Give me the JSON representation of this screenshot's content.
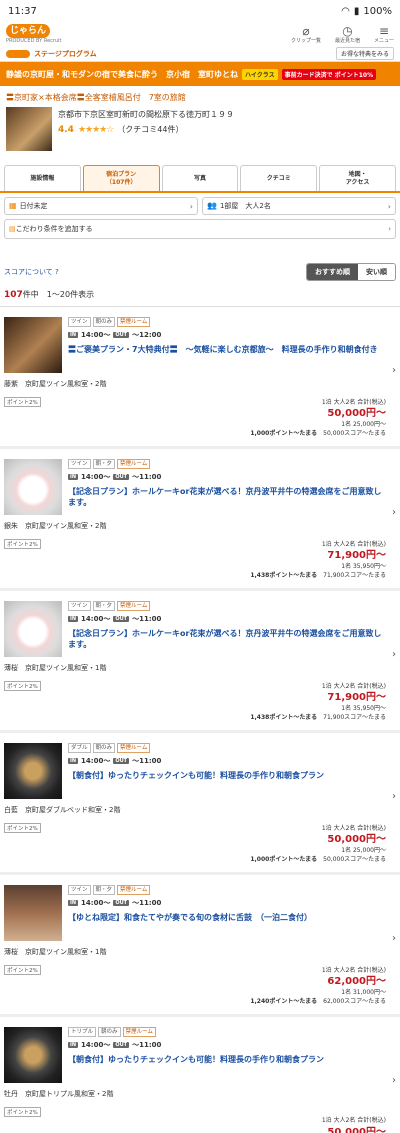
{
  "status_bar": {
    "time": "11:37",
    "battery": "100%"
  },
  "header": {
    "logo": "じゃらん",
    "logo_sub": "PRODUCED BY Recruit",
    "icons": [
      {
        "label": "クリップ一覧",
        "icon": "clip-icon"
      },
      {
        "label": "最近見た宿",
        "icon": "history-icon"
      },
      {
        "label": "メニュー",
        "icon": "menu-icon"
      }
    ]
  },
  "stage": {
    "label": "ステージプログラム",
    "link": "お得な特典をみる"
  },
  "banner": {
    "title": "静謐の京町屋・和モダンの宿で美食に酔う　京小宿　室町ゆとね",
    "badge1": "ハイクラス",
    "badge2": "事前カード決済で ポイント10%"
  },
  "catch": "〓京町家×本格会席〓全客室檜風呂付　7室の旅館",
  "hotel": {
    "address": "京都市下京区室町新町の間松原下る徳万町１９９",
    "score": "4.4",
    "stars": "★★★★☆",
    "reviews": "（クチコミ44件）"
  },
  "tabs": [
    {
      "label": "施設情報",
      "active": false
    },
    {
      "label": "宿泊プラン\n（107件）",
      "active": true
    },
    {
      "label": "写真",
      "active": false
    },
    {
      "label": "クチコミ",
      "active": false
    },
    {
      "label": "地図・\nアクセス",
      "active": false
    }
  ],
  "filters": {
    "date": "日付未定",
    "rooms": "1部屋　大人2名",
    "conditions": "こだわり条件を追加する"
  },
  "sort": {
    "about": "スコアについて",
    "recommended": "おすすめ順",
    "cheap": "安い順"
  },
  "count": {
    "total": "107",
    "unit": "件中",
    "range": "1〜20件表示"
  },
  "plans": [
    {
      "tags": [
        "ツイン",
        "朝のみ",
        "禁煙ルーム"
      ],
      "in": "14:00〜",
      "out": "〜12:00",
      "title": "〓ご褒美プラン・7大特典付〓　〜気軽に楽しむ京都旅〜　料理長の手作り和朝食付き",
      "room": "藤紫　京町屋ツイン風和室・2階",
      "point": "ポイント2%",
      "cond": "1泊 大人2名 合計(税込)",
      "price": "50,000円〜",
      "per": "1名 25,000円〜",
      "pts": "1,000ポイント〜たまる",
      "score": "50,000スコア〜たまる",
      "img": "room"
    },
    {
      "tags": [
        "ツイン",
        "朝・夕",
        "禁煙ルーム"
      ],
      "in": "14:00〜",
      "out": "〜11:00",
      "title": "【記念日プラン】ホールケーキor花束が選べる！京丹波平井牛の特選会席をご用意致します。",
      "room": "銀朱　京町屋ツイン風和室・2階",
      "point": "ポイント2%",
      "cond": "1泊 大人2名 合計(税込)",
      "price": "71,900円〜",
      "per": "1名 35,950円〜",
      "pts": "1,438ポイント〜たまる",
      "score": "71,900スコア〜たまる",
      "img": "cake"
    },
    {
      "tags": [
        "ツイン",
        "朝・夕",
        "禁煙ルーム"
      ],
      "in": "14:00〜",
      "out": "〜11:00",
      "title": "【記念日プラン】ホールケーキor花束が選べる！京丹波平井牛の特選会席をご用意致します。",
      "room": "薄桜　京町屋ツイン風和室・1階",
      "point": "ポイント2%",
      "cond": "1泊 大人2名 合計(税込)",
      "price": "71,900円〜",
      "per": "1名 35,950円〜",
      "pts": "1,438ポイント〜たまる",
      "score": "71,900スコア〜たまる",
      "img": "cake"
    },
    {
      "tags": [
        "ダブル",
        "朝のみ",
        "禁煙ルーム"
      ],
      "in": "14:00〜",
      "out": "〜11:00",
      "title": "【朝食付】ゆったりチェックインも可能！料理長の手作り和朝食プラン",
      "room": "白藍　京町屋ダブルベッド和室・2階",
      "point": "ポイント2%",
      "cond": "1泊 大人2名 合計(税込)",
      "price": "50,000円〜",
      "per": "1名 25,000円〜",
      "pts": "1,000ポイント〜たまる",
      "score": "50,000スコア〜たまる",
      "img": "food"
    },
    {
      "tags": [
        "ツイン",
        "朝・夕",
        "禁煙ルーム"
      ],
      "in": "14:00〜",
      "out": "〜11:00",
      "title": "【ゆとね限定】和食たてやが奏でる旬の食材に舌鼓　（一泊二食付）",
      "room": "薄桜　京町屋ツイン風和室・1階",
      "point": "ポイント2%",
      "cond": "1泊 大人2名 合計(税込)",
      "price": "62,000円〜",
      "per": "1名 31,000円〜",
      "pts": "1,240ポイント〜たまる",
      "score": "62,000スコア〜たまる",
      "img": "chef"
    },
    {
      "tags": [
        "トリプル",
        "朝のみ",
        "禁煙ルーム"
      ],
      "in": "14:00〜",
      "out": "〜11:00",
      "title": "【朝食付】ゆったりチェックインも可能！料理長の手作り和朝食プラン",
      "room": "牡丹　京町屋トリプル風和室・2階",
      "point": "ポイント2%",
      "cond": "1泊 大人2名 合計(税込)",
      "price": "50,000円〜",
      "per": "",
      "pts": "",
      "score": "",
      "img": "food"
    }
  ]
}
